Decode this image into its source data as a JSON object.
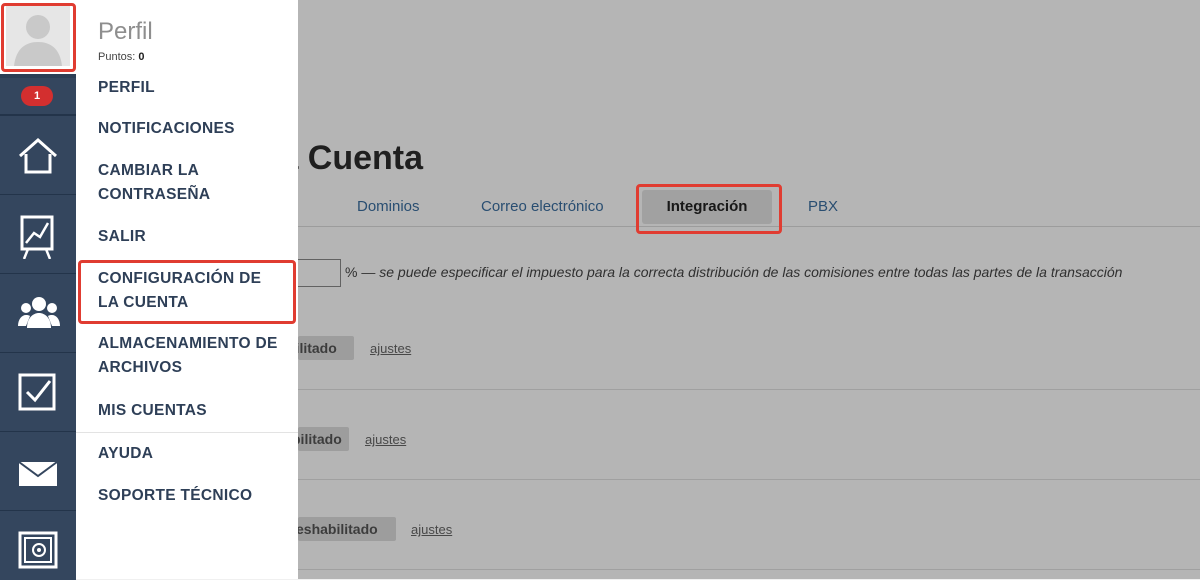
{
  "profile": {
    "title": "Perfil",
    "points_label": "Puntos:",
    "points_value": "0"
  },
  "badge": {
    "count": "1"
  },
  "menu": {
    "items": [
      "PERFIL",
      "NOTIFICACIONES",
      "CAMBIAR LA CONTRASEÑA",
      "SALIR",
      "CONFIGURACIÓN DE LA CUENTA",
      "ALMACENAMIENTO DE ARCHIVOS",
      "MIS CUENTAS",
      "AYUDA",
      "SOPORTE TÉCNICO"
    ]
  },
  "rail": {
    "icons": [
      "home-icon",
      "chart-icon",
      "users-icon",
      "checkbox-icon",
      "mail-icon",
      "safe-icon"
    ]
  },
  "page": {
    "title_fragment": "la Cuenta",
    "tabs": [
      "Dominios",
      "Correo electrónico",
      "Integración",
      "PBX"
    ],
    "active_tab": "Integración",
    "tax_unit": "%",
    "tax_hint": "— se puede especificar el impuesto para la correcta distribución de las comisiones entre todas las partes de la transacción",
    "rows": [
      {
        "status": "bilitado",
        "link": "ajustes"
      },
      {
        "status": "bilitado",
        "link": "ajustes"
      },
      {
        "status": "eshabilitado",
        "link": "ajustes"
      }
    ]
  },
  "colors": {
    "rail": "#2c3e55",
    "highlight": "#e03c31",
    "badge": "#d32f2f",
    "link": "#3b6ea0"
  }
}
